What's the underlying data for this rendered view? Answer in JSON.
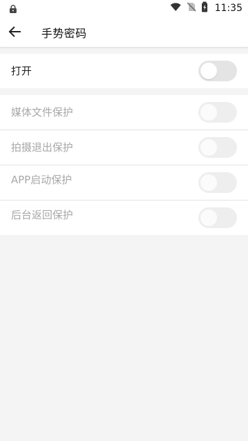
{
  "status_bar": {
    "time": "11:35",
    "icons": [
      "lock-icon",
      "wifi-icon",
      "no-sim-icon",
      "battery-charging-icon"
    ]
  },
  "app_bar": {
    "back_icon": "arrow-left-icon",
    "title": "手势密码"
  },
  "settings": {
    "main_toggle": {
      "label": "打开",
      "enabled": false
    },
    "options": [
      {
        "label": "媒体文件保护",
        "enabled": false,
        "disabled": true
      },
      {
        "label": "拍摄退出保护",
        "enabled": false,
        "disabled": true
      },
      {
        "label": "APP启动保护",
        "enabled": false,
        "disabled": true
      },
      {
        "label": "后台返回保护",
        "enabled": false,
        "disabled": true
      }
    ]
  },
  "colors": {
    "background": "#f4f4f4",
    "surface": "#ffffff",
    "disabled_text": "#a8a8a8",
    "toggle_track": "#e4e4e4"
  }
}
